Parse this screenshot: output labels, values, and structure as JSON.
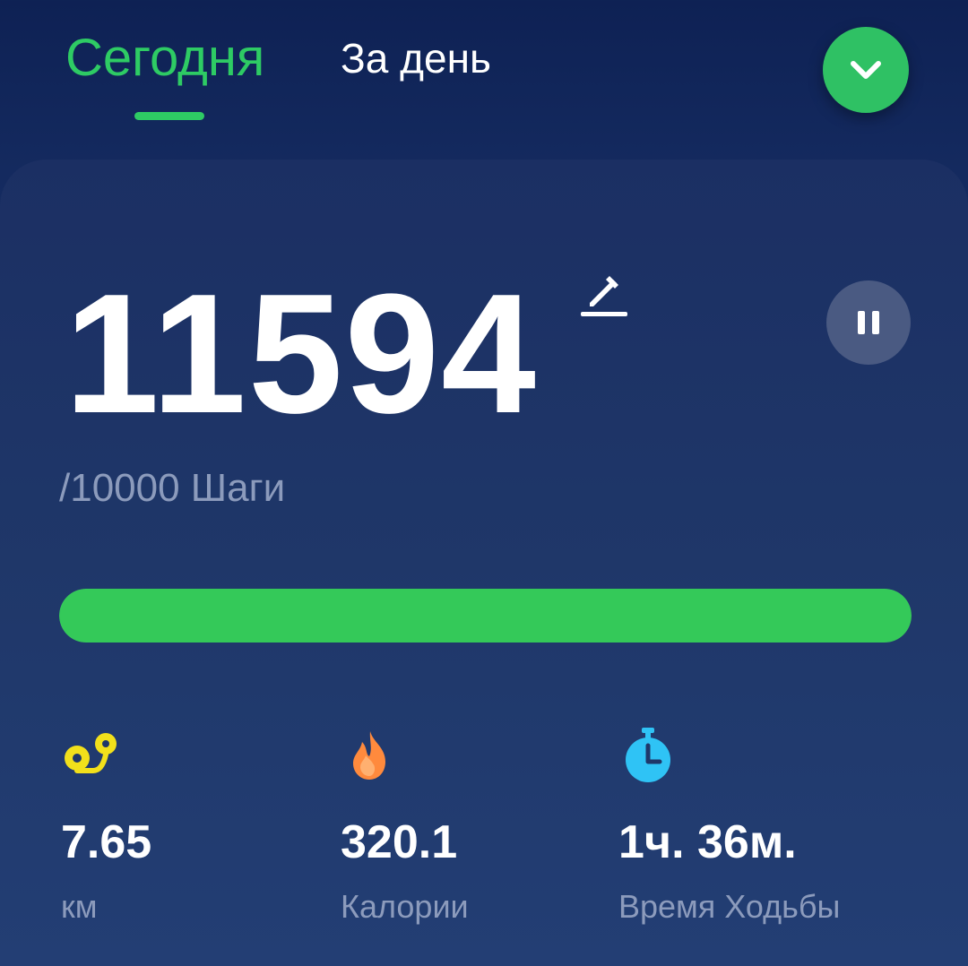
{
  "tabs": {
    "today_label": "Сегодня",
    "day_label": "За день"
  },
  "steps": {
    "count": "11594",
    "goal_text": "/10000 Шаги",
    "progress": 1.0
  },
  "stats": {
    "distance": {
      "value": "7.65",
      "label": "км",
      "icon": "route-icon"
    },
    "calories": {
      "value": "320.1",
      "label": "Калории",
      "icon": "flame-icon"
    },
    "time": {
      "value": "1ч. 36м.",
      "label": "Время Ходьбы",
      "icon": "stopwatch-icon"
    }
  },
  "colors": {
    "accent_green": "#2ecb64",
    "progress_green": "#34c959",
    "distance_yellow": "#f2e01b",
    "calories_orange": "#ff8a3d",
    "time_blue": "#2fc3f5"
  }
}
